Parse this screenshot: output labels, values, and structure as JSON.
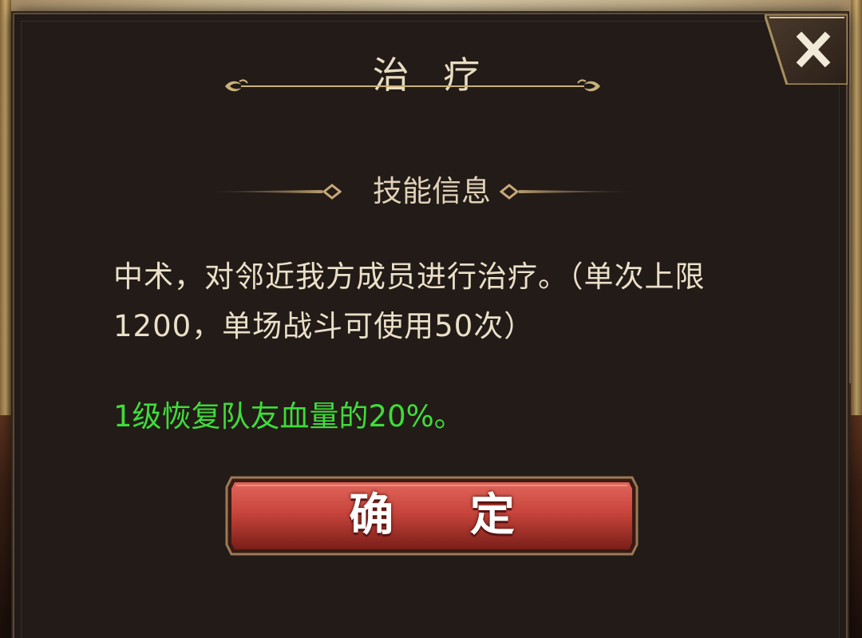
{
  "dialog": {
    "title": "治 疗",
    "close_icon": "close-x-icon"
  },
  "section": {
    "header": "技能信息"
  },
  "skill": {
    "description": "中术，对邻近我方成员进行治疗。（单次上限1200，单场战斗可使用50次）",
    "effect": "1级恢复队友血量的20%。"
  },
  "buttons": {
    "confirm_label": "确 定"
  },
  "colors": {
    "panel": "#221b17",
    "text_primary": "#eadfc8",
    "effect_green": "#3fdc3a",
    "button_red": "#c8453c",
    "gold_trim": "#c9b27a"
  }
}
